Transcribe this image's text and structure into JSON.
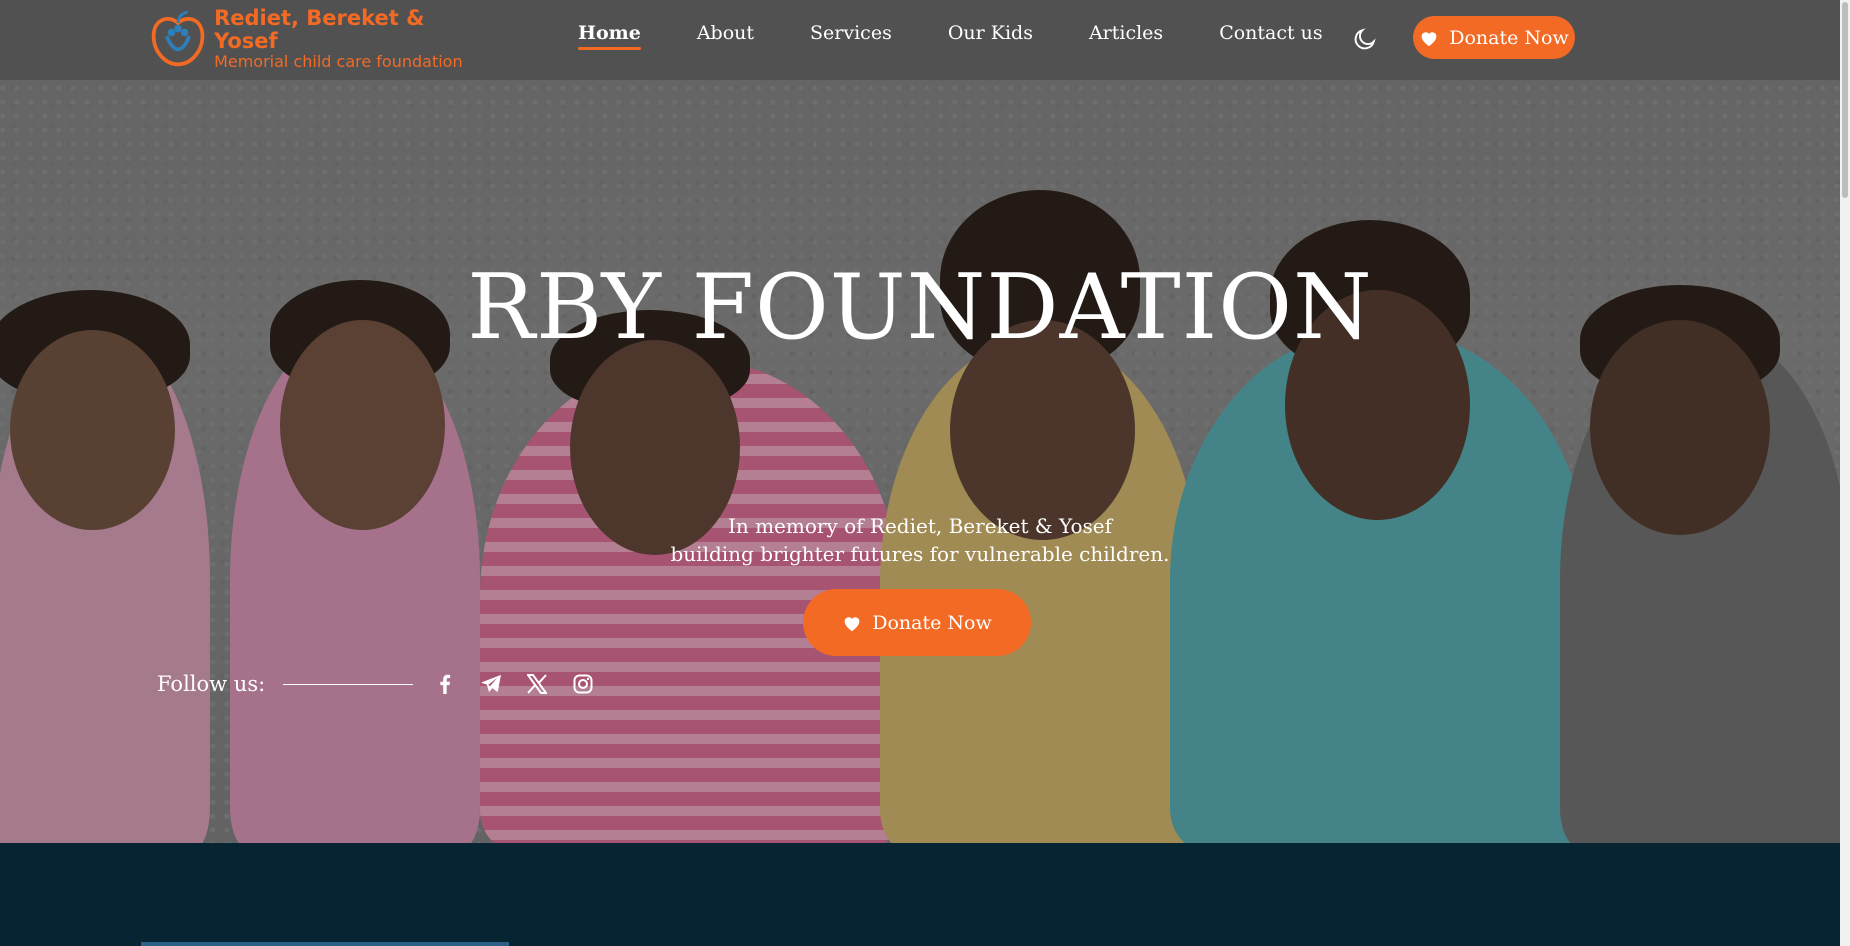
{
  "header": {
    "logo_title": "Rediet, Bereket & Yosef",
    "logo_subtitle": "Memorial child care foundation",
    "nav": [
      {
        "label": "Home",
        "active": true
      },
      {
        "label": "About"
      },
      {
        "label": "Services"
      },
      {
        "label": "Our Kids"
      },
      {
        "label": "Articles"
      },
      {
        "label": "Contact us"
      }
    ],
    "theme_icon": "moon-icon",
    "donate_label": "Donate Now"
  },
  "hero": {
    "title": "RBY FOUNDATION",
    "subtitle_line1": "In memory of Rediet, Bereket & Yosef",
    "subtitle_line2": "building brighter futures for vulnerable children.",
    "donate_label": "Donate Now",
    "follow_label": "Follow us:",
    "socials": [
      "facebook-icon",
      "telegram-icon",
      "x-icon",
      "instagram-icon"
    ]
  },
  "colors": {
    "accent": "#f26a24",
    "dark_section": "#062431",
    "section_accent": "#2c5f86"
  }
}
